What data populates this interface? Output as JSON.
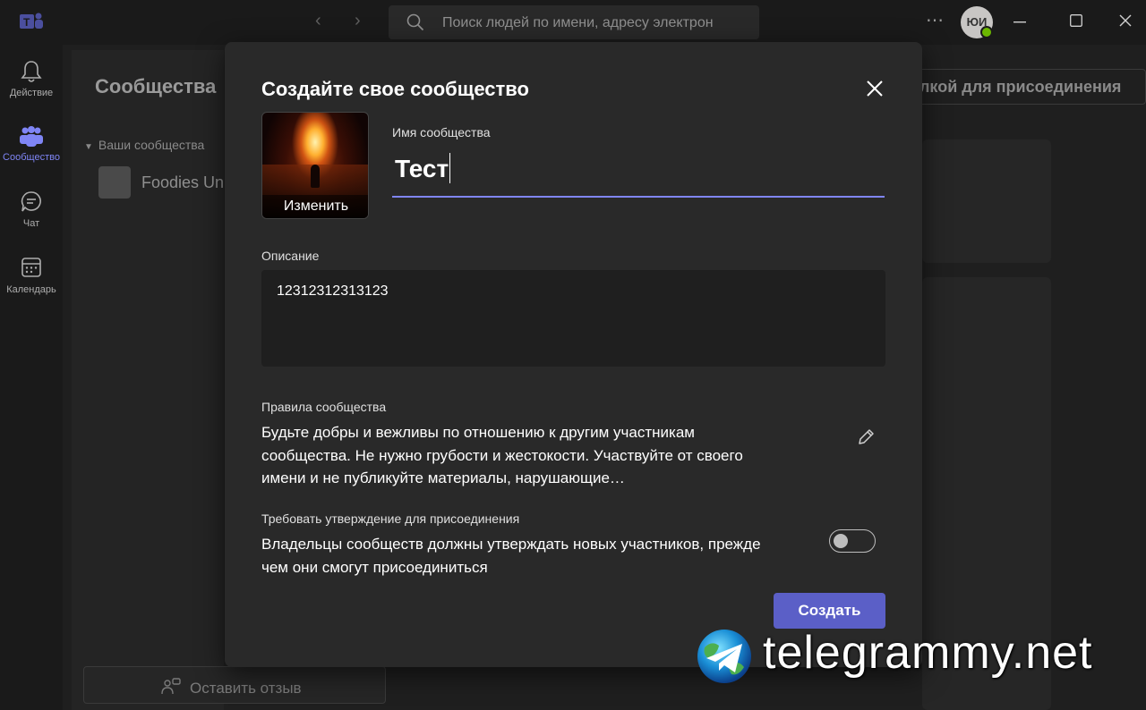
{
  "rail": {
    "items": [
      {
        "label": "Действие",
        "icon": "bell-icon"
      },
      {
        "label": "Сообщество",
        "icon": "people-icon"
      },
      {
        "label": "Чат",
        "icon": "chat-icon"
      },
      {
        "label": "Календарь",
        "icon": "calendar-icon"
      }
    ]
  },
  "topbar": {
    "search_placeholder": "Поиск людей по имени, адресу электрон",
    "avatar_initials": "ЮИ"
  },
  "background": {
    "side_title": "Сообщества",
    "group_label": "Ваши сообщества",
    "community_name": "Foodies Un",
    "feedback_label": "Оставить отзыв",
    "join_link_label": "лкой для присоединения"
  },
  "dialog": {
    "title": "Создайте свое сообщество",
    "change_photo_label": "Изменить",
    "name_label": "Имя сообщества",
    "name_value": "Тест",
    "description_label": "Описание",
    "description_value": "12312312313123",
    "rules_label": "Правила сообщества",
    "rules_text": "Будьте добры и вежливы по отношению к другим участникам сообщества. Не нужно грубости и жестокости. Участвуйте от своего имени и не публикуйте материалы, нарушающие…",
    "approval_label": "Требовать утверждение для присоединения",
    "approval_text": "Владельцы сообществ должны утверждать новых участников, прежде чем они смогут присоединиться",
    "approval_enabled": false,
    "create_button": "Создать"
  },
  "watermark": {
    "text": "telegrammy.net"
  },
  "colors": {
    "accent": "#5b5fc7",
    "accent_light": "#7f85f5",
    "dialog_bg": "#292929",
    "app_bg": "#1f1f1f"
  }
}
